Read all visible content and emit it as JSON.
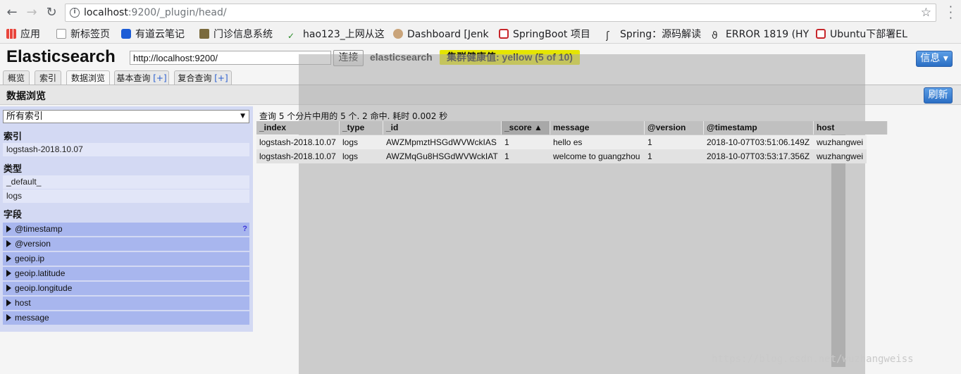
{
  "browser": {
    "url_host": "localhost",
    "url_rest": ":9200/_plugin/head/",
    "bookmarks": [
      {
        "label": "应用",
        "icon": "apps-grid-icon"
      },
      {
        "label": "新标签页",
        "icon": "page-icon"
      },
      {
        "label": "有道云笔记",
        "icon": "youdao-icon"
      },
      {
        "label": "门诊信息系统",
        "icon": "picture-icon"
      },
      {
        "label": "hao123_上网从这",
        "icon": "hao123-icon"
      },
      {
        "label": "Dashboard [Jenk",
        "icon": "jenkins-icon"
      },
      {
        "label": "SpringBoot 项目",
        "icon": "csdn-icon"
      },
      {
        "label": "Spring：源码解读",
        "icon": "spring-icon"
      },
      {
        "label": "ERROR 1819 (HY",
        "icon": "mysql-icon"
      },
      {
        "label": "Ubuntu下部署EL",
        "icon": "csdn-icon"
      }
    ]
  },
  "app": {
    "title": "Elasticsearch",
    "cluster_url": "http://localhost:9200/",
    "connect_label": "连接",
    "cluster_name": "elasticsearch",
    "health": "集群健康值: yellow (5 of 10)",
    "info_label": "信息 ▾",
    "health_color": "#e5e500"
  },
  "tabs": [
    {
      "label": "概览"
    },
    {
      "label": "索引"
    },
    {
      "label": "数据浏览"
    },
    {
      "label": "基本查询",
      "plus": "[+]"
    },
    {
      "label": "复合查询",
      "plus": "[+]"
    }
  ],
  "browser_view": {
    "title": "数据浏览",
    "refresh_label": "刷新",
    "index_select": "所有索引",
    "index_heading": "索引",
    "indices": [
      "logstash-2018.10.07"
    ],
    "type_heading": "类型",
    "types": [
      "_default_",
      "logs"
    ],
    "field_heading": "字段",
    "fields": [
      "@timestamp",
      "@version",
      "geoip.ip",
      "geoip.latitude",
      "geoip.longitude",
      "host",
      "message"
    ],
    "field_help": "?"
  },
  "results": {
    "summary": "查询 5 个分片中用的 5 个. 2 命中. 耗时 0.002 秒",
    "columns": [
      "_index",
      "_type",
      "_id",
      "_score ▲",
      "message",
      "@version",
      "@timestamp",
      "host"
    ],
    "rows": [
      [
        "logstash-2018.10.07",
        "logs",
        "AWZMpmztHSGdWVWckIAS",
        "1",
        "hello es",
        "1",
        "2018-10-07T03:51:06.149Z",
        "wuzhangwei"
      ],
      [
        "logstash-2018.10.07",
        "logs",
        "AWZMqGu8HSGdWVWckIAT",
        "1",
        "welcome to guangzhou",
        "1",
        "2018-10-07T03:53:17.356Z",
        "wuzhangwei"
      ]
    ]
  },
  "watermark": "https://blog.csdn.net/wuzhangweiss"
}
